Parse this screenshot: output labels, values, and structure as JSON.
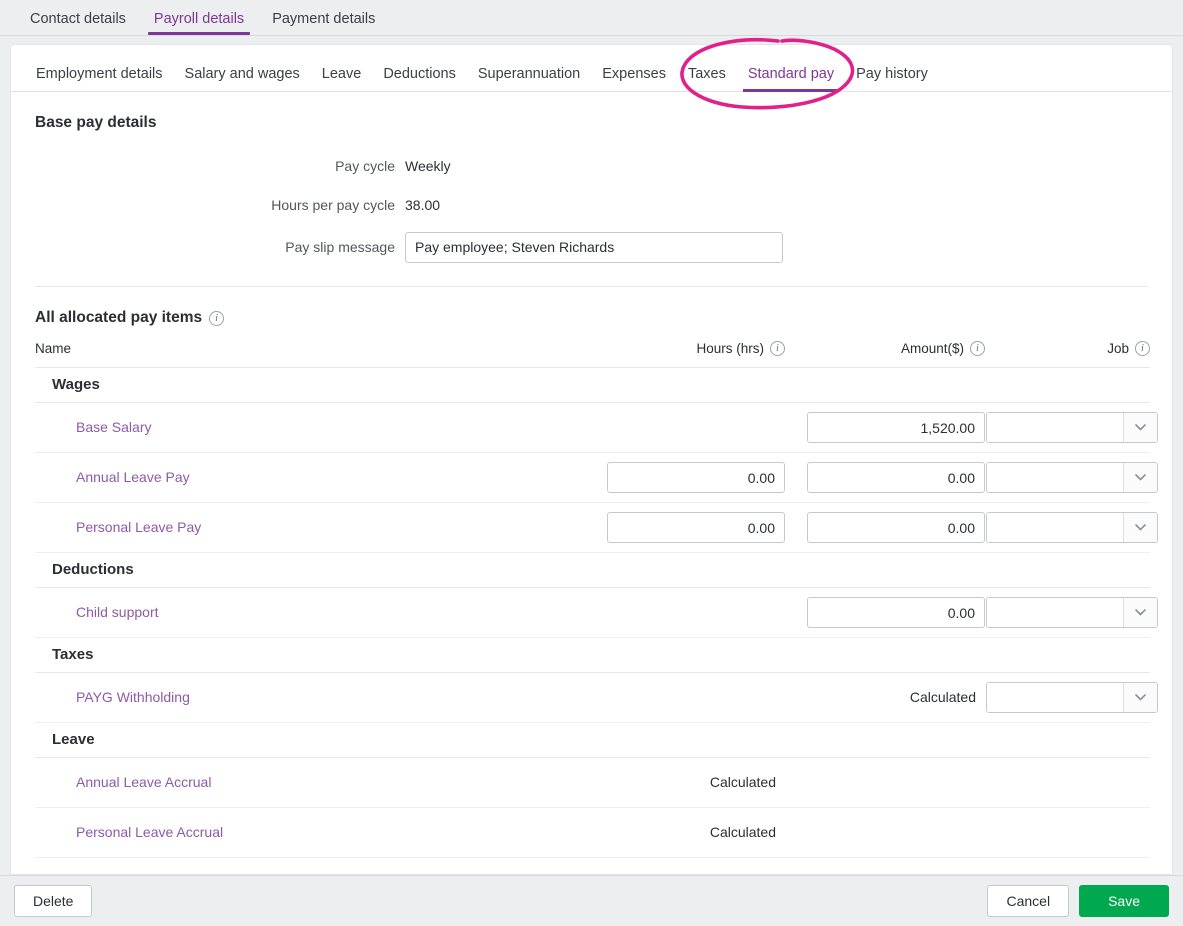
{
  "top_tabs": [
    {
      "label": "Contact details",
      "active": false
    },
    {
      "label": "Payroll details",
      "active": true
    },
    {
      "label": "Payment details",
      "active": false
    }
  ],
  "sub_tabs": [
    {
      "label": "Employment details",
      "active": false
    },
    {
      "label": "Salary and wages",
      "active": false
    },
    {
      "label": "Leave",
      "active": false
    },
    {
      "label": "Deductions",
      "active": false
    },
    {
      "label": "Superannuation",
      "active": false
    },
    {
      "label": "Expenses",
      "active": false
    },
    {
      "label": "Taxes",
      "active": false
    },
    {
      "label": "Standard pay",
      "active": true
    },
    {
      "label": "Pay history",
      "active": false
    }
  ],
  "base_pay": {
    "heading": "Base pay details",
    "pay_cycle_label": "Pay cycle",
    "pay_cycle_value": "Weekly",
    "hours_label": "Hours per pay cycle",
    "hours_value": "38.00",
    "pay_slip_message_label": "Pay slip message",
    "pay_slip_message_value": "Pay employee; Steven Richards"
  },
  "pay_items": {
    "heading": "All allocated pay items",
    "heading_info_icon": "info-icon",
    "columns": {
      "name": "Name",
      "hours": "Hours (hrs)",
      "amount": "Amount($)",
      "job": "Job"
    },
    "groups": [
      {
        "label": "Wages",
        "rows": [
          {
            "name": "Base Salary",
            "hours_type": "none",
            "hours": "",
            "amount_type": "input",
            "amount": "1,520.00",
            "job_type": "select"
          },
          {
            "name": "Annual Leave Pay",
            "hours_type": "input",
            "hours": "0.00",
            "amount_type": "input",
            "amount": "0.00",
            "job_type": "select"
          },
          {
            "name": "Personal Leave Pay",
            "hours_type": "input",
            "hours": "0.00",
            "amount_type": "input",
            "amount": "0.00",
            "job_type": "select"
          }
        ]
      },
      {
        "label": "Deductions",
        "rows": [
          {
            "name": "Child support",
            "hours_type": "none",
            "hours": "",
            "amount_type": "input",
            "amount": "0.00",
            "job_type": "select"
          }
        ]
      },
      {
        "label": "Taxes",
        "rows": [
          {
            "name": "PAYG Withholding",
            "hours_type": "none",
            "hours": "",
            "amount_type": "text",
            "amount": "Calculated",
            "job_type": "select"
          }
        ]
      },
      {
        "label": "Leave",
        "rows": [
          {
            "name": "Annual Leave Accrual",
            "hours_type": "text",
            "hours": "Calculated",
            "amount_type": "none",
            "amount": "",
            "job_type": "none"
          },
          {
            "name": "Personal Leave Accrual",
            "hours_type": "text",
            "hours": "Calculated",
            "amount_type": "none",
            "amount": "",
            "job_type": "none"
          }
        ]
      }
    ]
  },
  "footer": {
    "delete_label": "Delete",
    "cancel_label": "Cancel",
    "save_label": "Save"
  },
  "annotation": {
    "shape": "ellipse-highlight",
    "target": "Standard pay",
    "color": "#e0218a"
  },
  "colors": {
    "accent_purple": "#7e3794",
    "link_purple": "#8d5ba6",
    "save_green": "#00a850",
    "annotation_pink": "#e0218a"
  }
}
